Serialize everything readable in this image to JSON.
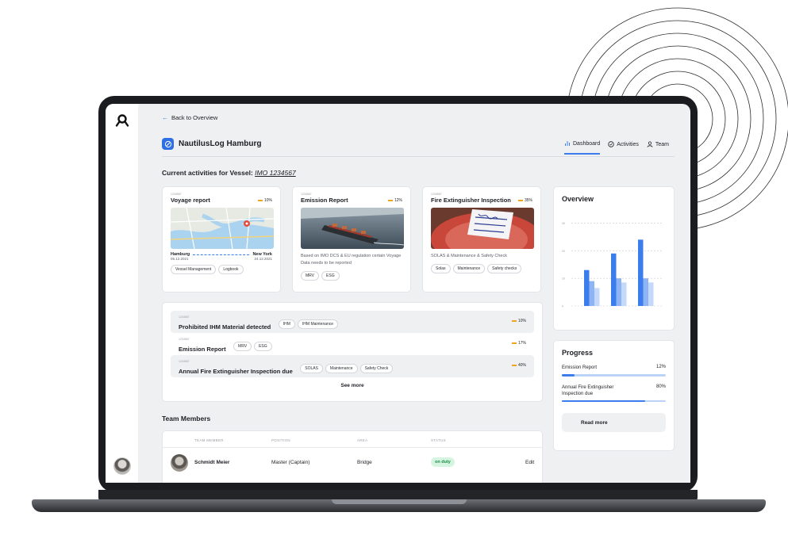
{
  "app": {
    "back_label": "Back to Overview",
    "vessel_name": "NautilusLog Hamburg",
    "accent_color": "#3b7ded"
  },
  "tabs": [
    {
      "label": "Dashboard",
      "icon": "bar-chart-icon",
      "active": true
    },
    {
      "label": "Activities",
      "icon": "check-circle-icon",
      "active": false
    },
    {
      "label": "Team",
      "icon": "person-icon",
      "active": false
    }
  ],
  "vessel_line": {
    "prefix": "Current activities for Vessel:",
    "imo": "IMO 1234567"
  },
  "activity_cards": [
    {
      "id": "1234567",
      "title": "Voyage report",
      "percent": "10%",
      "from_city": "Hamburg",
      "from_date": "05.12.2021",
      "to_city": "New York",
      "to_date": "24.12.2021",
      "tags": [
        "Vessel Management",
        "Logbook"
      ]
    },
    {
      "id": "1234567",
      "title": "Emission Report",
      "percent": "12%",
      "description": "Based on IMO DCS & EU regulation certain Voyage Data needs to be reported",
      "tags": [
        "MRV",
        "ESG"
      ]
    },
    {
      "id": "1234567",
      "title": "Fire Extinguisher Inspection",
      "percent": "35%",
      "description": "SOLAS & Maintenance & Safety Check",
      "tags": [
        "Solas",
        "Maintenance",
        "Safety checks"
      ]
    }
  ],
  "activity_list": [
    {
      "id": "1234567",
      "title": "Prohibited IHM Material detected",
      "tags": [
        "IHM",
        "IHM Maintenance"
      ],
      "percent": "10%"
    },
    {
      "id": "1234567",
      "title": "Emission Report",
      "tags": [
        "MRV",
        "ESG"
      ],
      "percent": "17%"
    },
    {
      "id": "1234567",
      "title": "Annual Fire Extinguisher Inspection due",
      "tags": [
        "SOLAS",
        "Maintenance",
        "Safety Check"
      ],
      "percent": "40%"
    }
  ],
  "see_more_label": "See more",
  "team": {
    "title": "Team Members",
    "headers": [
      "TEAM MEMBER",
      "POSITION",
      "AREA",
      "STATUS"
    ],
    "rows": [
      {
        "name": "Schmidt Meier",
        "position": "Master (Captain)",
        "area": "Bridge",
        "status": "on duty",
        "action": "Edit"
      }
    ]
  },
  "overview": {
    "title": "Overview"
  },
  "chart_data": {
    "type": "bar",
    "title": "Overview",
    "categories": [
      "1",
      "2",
      "3"
    ],
    "ylim": [
      0,
      35
    ],
    "yticks": [
      "0",
      "10",
      "20",
      "30"
    ],
    "grid": true,
    "series": [
      {
        "values": [
          13,
          19,
          24
        ],
        "color": "#3b7ded"
      },
      {
        "values": [
          9,
          10,
          10
        ],
        "color": "#8fb4f3"
      },
      {
        "values": [
          6.5,
          8.5,
          8.5
        ],
        "color": "#c4d8f9"
      }
    ]
  },
  "progress": {
    "title": "Progress",
    "items": [
      {
        "label": "Emission Report",
        "value_label": "12%",
        "fraction": 0.12
      },
      {
        "label": "Annual Fire Extinguisher Inspection due",
        "value_label": "80%",
        "fraction": 0.8
      }
    ],
    "read_more_label": "Read more"
  }
}
